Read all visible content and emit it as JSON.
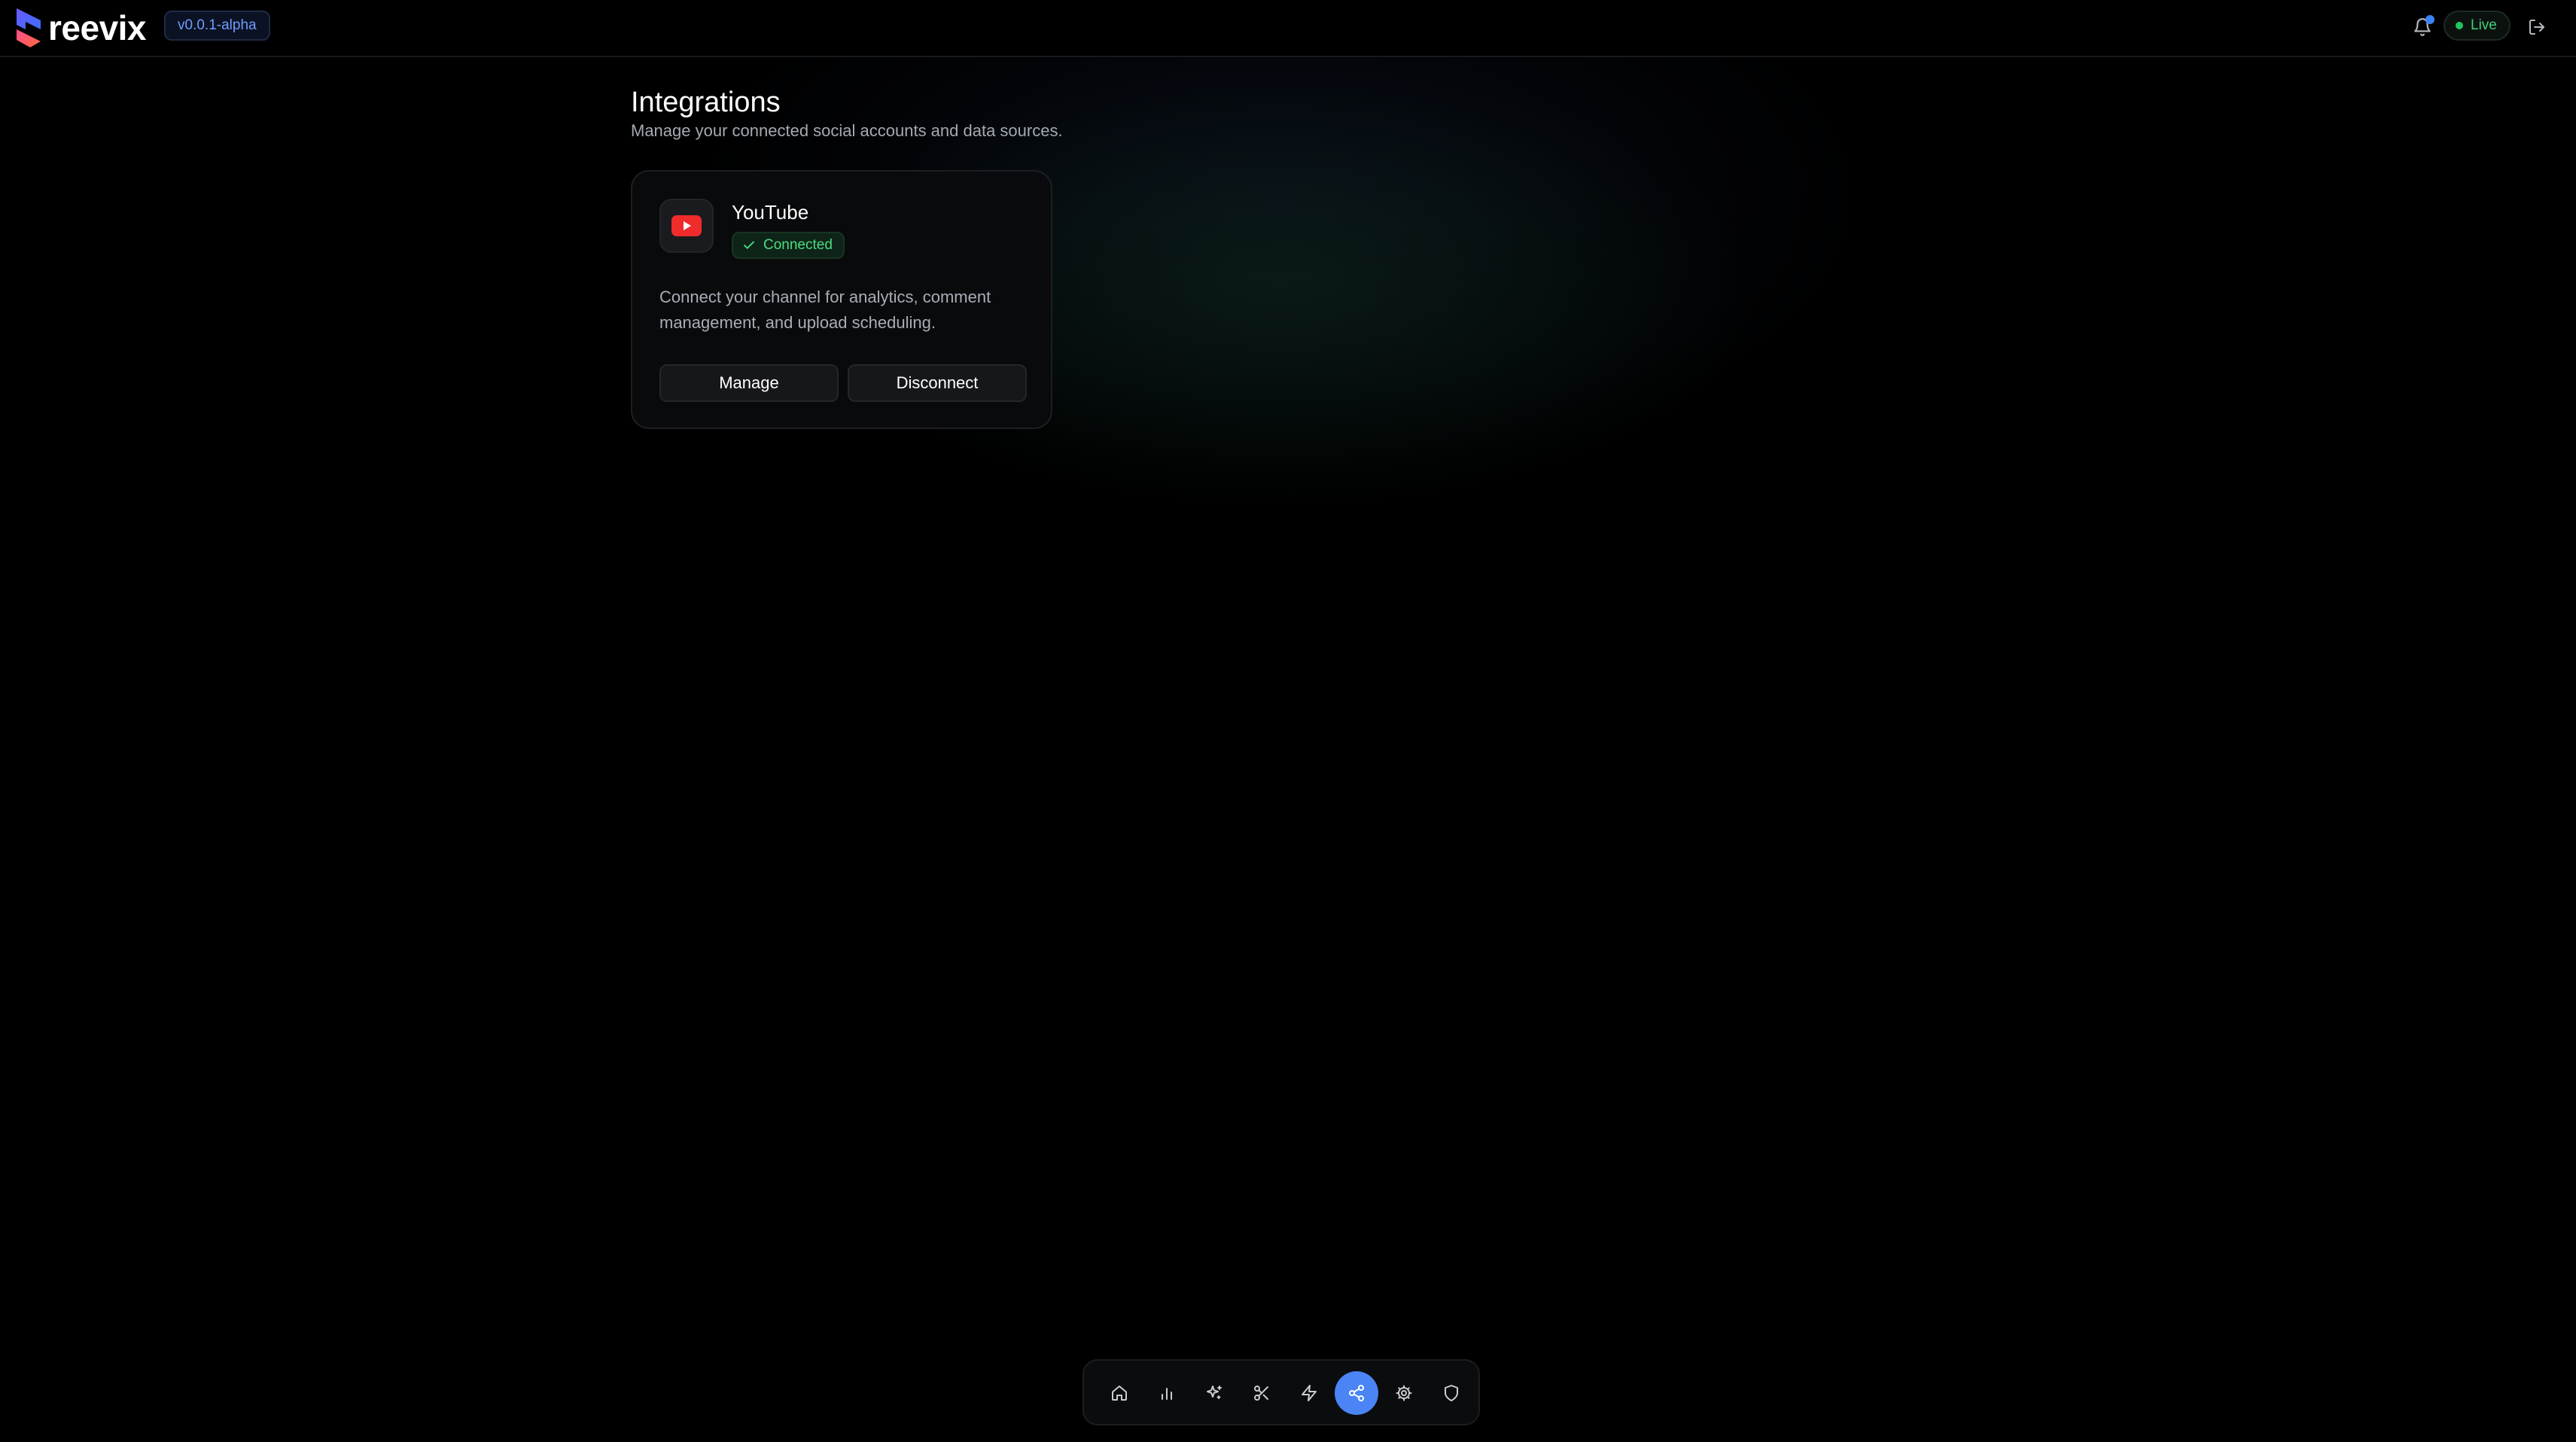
{
  "app": {
    "name": "reevix",
    "version": "v0.0.1-alpha",
    "status_label": "Live",
    "accent_color": "#4a84f5",
    "live_color": "#22c55e"
  },
  "header": {
    "notifications_icon": "bell-icon",
    "logout_icon": "logout-icon"
  },
  "main": {
    "title": "Integrations",
    "subtitle": "Manage your connected social accounts and data sources."
  },
  "integrations": [
    {
      "name": "YouTube",
      "icon": "youtube-icon",
      "status": "Connected",
      "description": "Connect your channel for analytics, comment management, and upload scheduling.",
      "actions": {
        "manage": "Manage",
        "disconnect": "Disconnect"
      }
    }
  ],
  "dock": {
    "active_index": 5,
    "items": [
      {
        "icon": "home-icon"
      },
      {
        "icon": "bar-chart-icon"
      },
      {
        "icon": "sparkles-icon"
      },
      {
        "icon": "scissors-icon"
      },
      {
        "icon": "zap-icon"
      },
      {
        "icon": "share-icon"
      },
      {
        "icon": "settings-icon"
      },
      {
        "icon": "shield-icon"
      }
    ]
  }
}
